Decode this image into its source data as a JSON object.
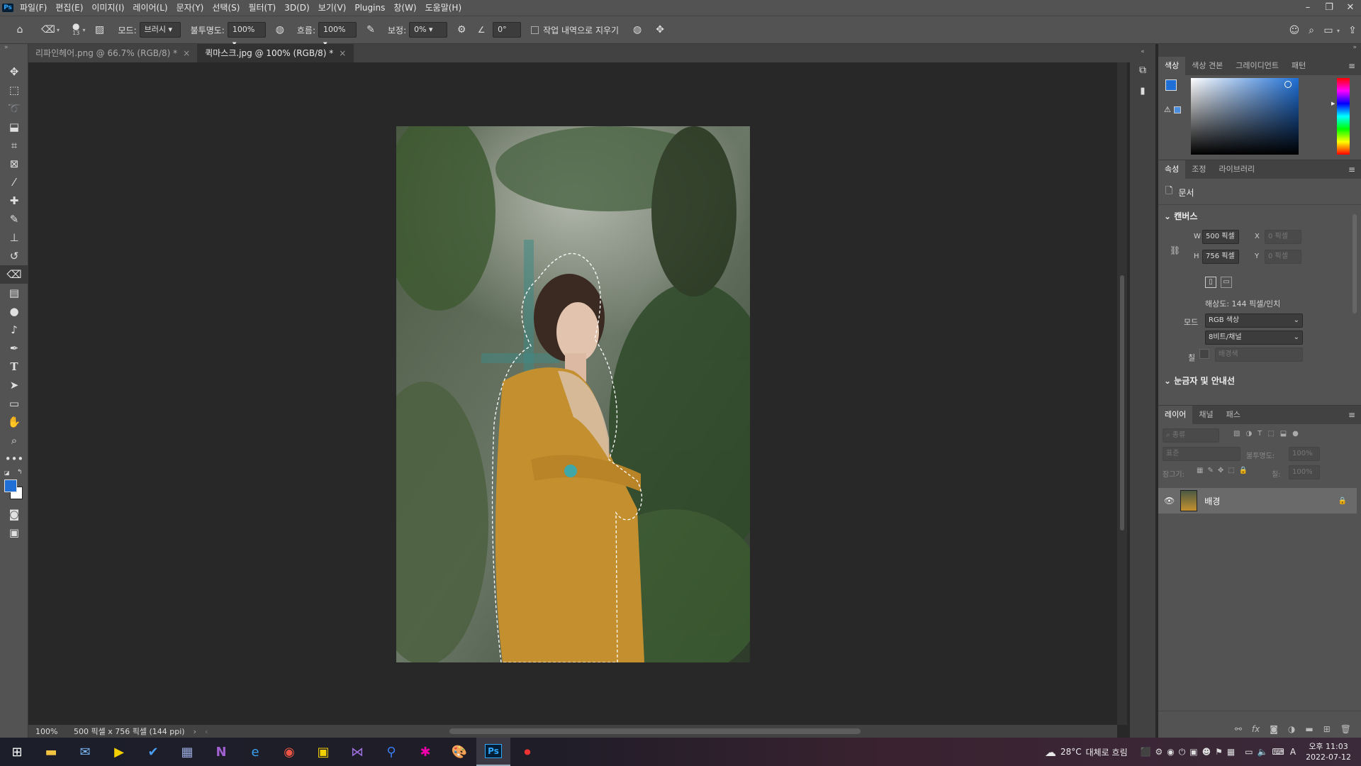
{
  "menubar": {
    "app_logo": "Ps",
    "items": [
      "파일(F)",
      "편집(E)",
      "이미지(I)",
      "레이어(L)",
      "문자(Y)",
      "선택(S)",
      "필터(T)",
      "3D(D)",
      "보기(V)",
      "Plugins",
      "창(W)",
      "도움말(H)"
    ]
  },
  "options": {
    "brush_size": "13",
    "mode_label": "모드:",
    "mode_value": "브러시",
    "opacity_label": "불투명도:",
    "opacity_value": "100%",
    "flow_label": "흐름:",
    "flow_value": "100%",
    "smoothing_label": "보정:",
    "smoothing_value": "0%",
    "angle_value": "0°",
    "erase_history_label": "작업 내역으로 지우기"
  },
  "tabs": [
    {
      "label": "리파인헤어.png @ 66.7% (RGB/8) *",
      "close": "×"
    },
    {
      "label": "퀵마스크.jpg @ 100% (RGB/8) *",
      "close": "×"
    }
  ],
  "status": {
    "zoom": "100%",
    "doc_info": "500 픽셀 x 756 픽셀 (144 ppi)"
  },
  "color_panel": {
    "tabs": [
      "색상",
      "색상 견본",
      "그레이디언트",
      "패턴"
    ],
    "foreground": "#1f6fd6",
    "background": "#ffffff"
  },
  "properties": {
    "tabs": [
      "속성",
      "조정",
      "라이브러리"
    ],
    "doc_label": "문서",
    "canvas_section": "캔버스",
    "w_label": "W",
    "w_value": "500 픽셀",
    "h_label": "H",
    "h_value": "756 픽셀",
    "x_label": "X",
    "x_value": "0 픽셀",
    "y_label": "Y",
    "y_value": "0 픽셀",
    "resolution": "해상도: 144 픽셀/인치",
    "mode_label": "모드",
    "mode_value": "RGB 색상",
    "bit_depth": "8비트/채널",
    "fill_label": "칠",
    "fill_value": "배경색",
    "rulers_section": "눈금자 및 안내선"
  },
  "layers": {
    "tabs": [
      "레이어",
      "채널",
      "패스"
    ],
    "search_placeholder": "종류",
    "blend_mode": "표준",
    "opacity_label": "불투명도:",
    "opacity_value": "100%",
    "lock_label": "잠그기:",
    "fill_label": "칠:",
    "fill_value": "100%",
    "items": [
      {
        "name": "배경"
      }
    ]
  },
  "taskbar": {
    "weather_temp": "28°C",
    "weather_desc": "대체로 흐림",
    "ime": "A",
    "time": "오후 11:03",
    "date": "2022-07-12"
  },
  "colors": {
    "ps_blue": "#31a8ff",
    "selection_ant": "#ffffff"
  }
}
